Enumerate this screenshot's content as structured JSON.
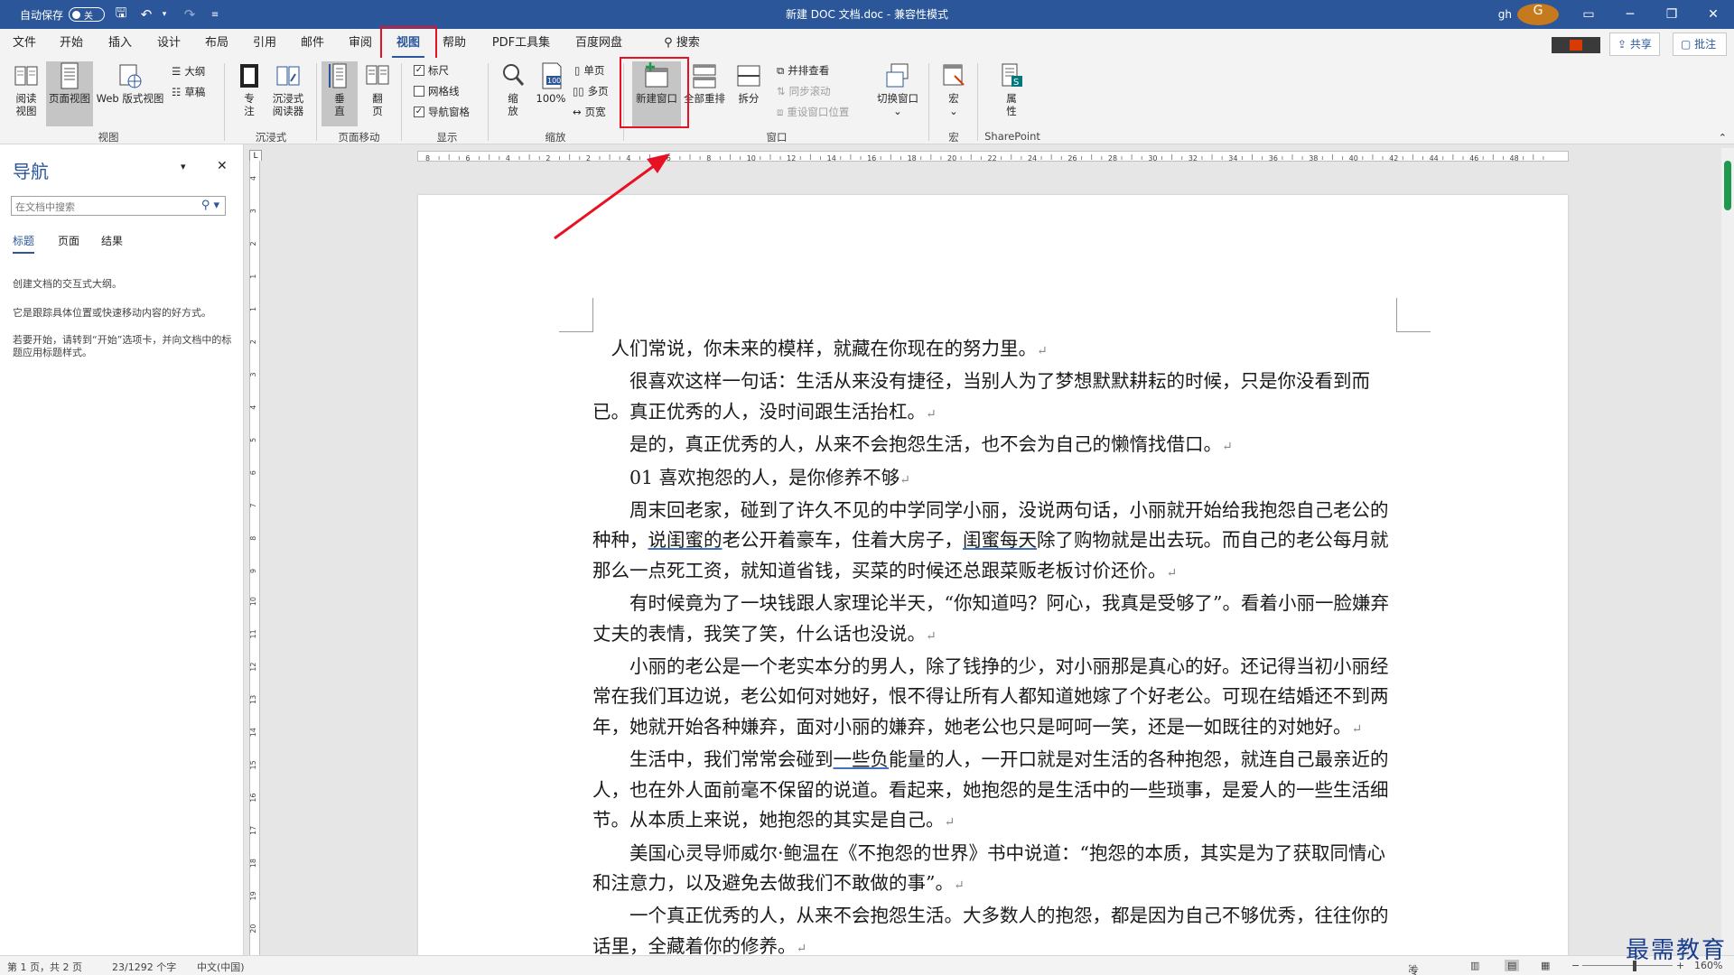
{
  "titlebar": {
    "autosave_label": "自动保存",
    "autosave_state": "关",
    "doc_title": "新建 DOC 文档.doc",
    "mode": "兼容性模式",
    "user": "gh",
    "avatar_letter": "G"
  },
  "tabs": [
    "文件",
    "开始",
    "插入",
    "设计",
    "布局",
    "引用",
    "邮件",
    "审阅",
    "视图",
    "帮助",
    "PDF工具集",
    "百度网盘"
  ],
  "search_label": "搜索",
  "share_label": "共享",
  "comment_label": "批注",
  "ribbon": {
    "read_view": "阅读\n视图",
    "print_layout": "页面视图",
    "web_layout": "Web 版式视图",
    "outline": "大纲",
    "draft": "草稿",
    "focus": "专\n注",
    "immersive_reader": "沉浸式\n阅读器",
    "vertical": "垂\n直",
    "side_to_side": "翻\n页",
    "ruler": "标尺",
    "gridlines": "网格线",
    "nav_pane": "导航窗格",
    "zoom": "缩\n放",
    "zoom100": "100%",
    "one_page": "单页",
    "multi_page": "多页",
    "page_width": "页宽",
    "new_window": "新建窗口",
    "arrange_all": "全部重排",
    "split": "拆分",
    "view_side_by_side": "并排查看",
    "sync_scroll": "同步滚动",
    "reset_window": "重设窗口位置",
    "switch_windows": "切换窗口",
    "macros": "宏",
    "properties": "属\n性",
    "groups": {
      "views": "视图",
      "immersive": "沉浸式",
      "page_movement": "页面移动",
      "show": "显示",
      "zoom": "缩放",
      "window": "窗口",
      "macros": "宏",
      "sharepoint": "SharePoint"
    }
  },
  "nav": {
    "title": "导航",
    "search_placeholder": "在文档中搜索",
    "tabs": [
      "标题",
      "页面",
      "结果"
    ],
    "p1": "创建文档的交互式大纲。",
    "p2": "它是跟踪具体位置或快速移动内容的好方式。",
    "p3": "若要开始，请转到“开始”选项卡，并向文档中的标题应用标题样式。"
  },
  "ruler_h": [
    "8",
    "6",
    "4",
    "2",
    "2",
    "4",
    "6",
    "8",
    "10",
    "12",
    "14",
    "16",
    "18",
    "20",
    "22",
    "24",
    "26",
    "28",
    "30",
    "32",
    "34",
    "36",
    "38",
    "40",
    "42",
    "44",
    "46",
    "48"
  ],
  "ruler_v": [
    "4",
    "3",
    "2",
    "1",
    "1",
    "2",
    "3",
    "4",
    "5",
    "6",
    "7",
    "8",
    "9",
    "10",
    "11",
    "12",
    "13",
    "14",
    "15",
    "16",
    "17",
    "18",
    "19",
    "20"
  ],
  "doc": {
    "p1": "人们常说，你未来的模样，就藏在你现在的努力里。",
    "p2": "很喜欢这样一句话：生活从来没有捷径，当别人为了梦想默默耕耘的时候，只是你没看到而已。真正优秀的人，没时间跟生活抬杠。",
    "p3": "是的，真正优秀的人，从来不会抱怨生活，也不会为自己的懒惰找借口。",
    "p4": "01 喜欢抱怨的人，是你修养不够",
    "p5a": "周末回老家，碰到了许久不见的中学同学小丽，没说两句话，小丽就开始给我抱怨自己老公的种种，",
    "p5u1": "说闺蜜的",
    "p5b": "老公开着豪车，住着大房子，",
    "p5u2": "闺蜜每天",
    "p5c": "除了购物就是出去玩。而自己的老公每月就那么一点死工资，就知道省钱，买菜的时候还总跟菜贩老板讨价还价。",
    "p6": "有时候竟为了一块钱跟人家理论半天，“你知道吗？阿心，我真是受够了”。看着小丽一脸嫌弃丈夫的表情，我笑了笑，什么话也没说。",
    "p7": "小丽的老公是一个老实本分的男人，除了钱挣的少，对小丽那是真心的好。还记得当初小丽经常在我们耳边说，老公如何对她好，恨不得让所有人都知道她嫁了个好老公。可现在结婚还不到两年，她就开始各种嫌弃，面对小丽的嫌弃，她老公也只是呵呵一笑，还是一如既往的对她好。",
    "p8a": "生活中，我们常常会碰到",
    "p8u": "一些负",
    "p8b": "能量的人，一开口就是对生活的各种抱怨，就连自己最亲近的人，也在外人面前毫不保留的说道。看起来，她抱怨的是生活中的一些琐事，是爱人的一些生活细节。从本质上来说，她抱怨的其实是自己。",
    "p9": "美国心灵导师威尔·鲍温在《不抱怨的世界》书中说道：“抱怨的本质，其实是为了获取同情心和注意力，以及避免去做我们不敢做的事”。",
    "p10": "一个真正优秀的人，从来不会抱怨生活。大多数人的抱怨，都是因为自己不够优秀，往往你的话里，全藏着你的修养。",
    "para_mark": "↵"
  },
  "status": {
    "page": "第 1 页，共 2 页",
    "words": "23/1292 个字",
    "lang": "中文(中国)",
    "focus": "专注",
    "zoom": "160%"
  },
  "watermark": "最需教育"
}
